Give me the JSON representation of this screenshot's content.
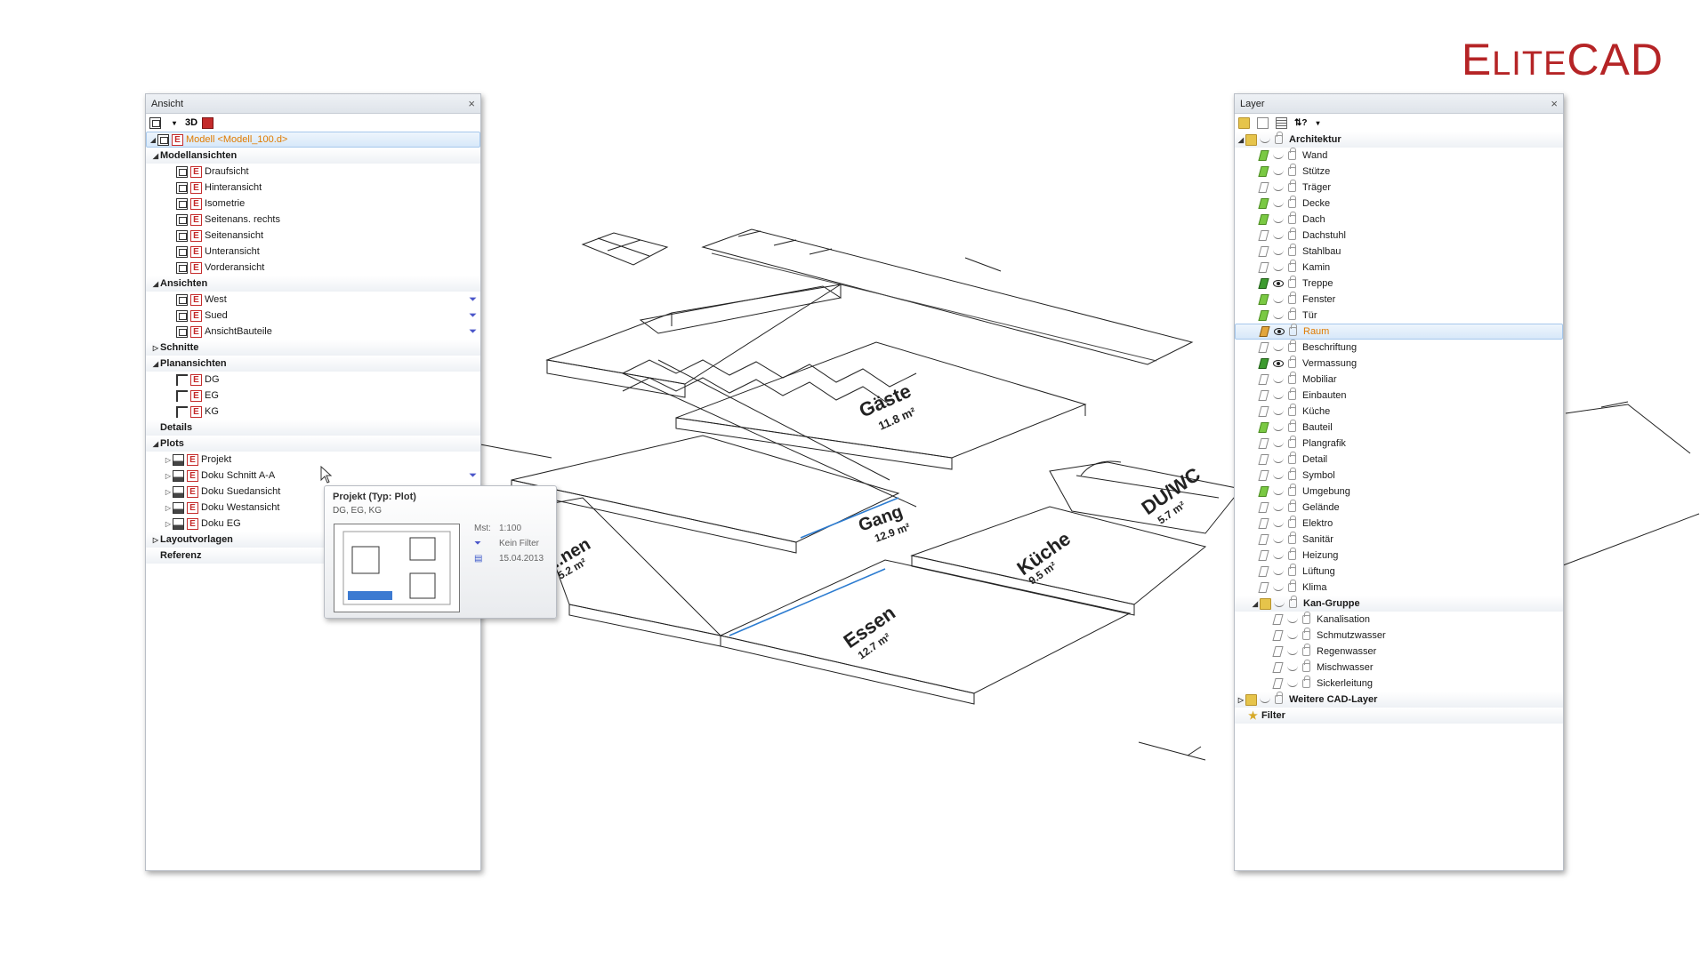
{
  "logo": {
    "first_big": "E",
    "first_small": "LITE",
    "rest": "CAD"
  },
  "ansicht": {
    "title": "Ansicht",
    "close": "×",
    "toolbar": {
      "mode_label": "3D"
    },
    "model_label": "Modell <Modell_100.d>",
    "modellansichten": {
      "label": "Modellansichten",
      "items": [
        "Draufsicht",
        "Hinteransicht",
        "Isometrie",
        "Seitenans. rechts",
        "Seitenansicht",
        "Unteransicht",
        "Vorderansicht"
      ]
    },
    "ansichten": {
      "label": "Ansichten",
      "items": [
        "West",
        "Sued",
        "AnsichtBauteile"
      ]
    },
    "schnitte": {
      "label": "Schnitte"
    },
    "planansichten": {
      "label": "Planansichten",
      "items": [
        "DG",
        "EG",
        "KG"
      ]
    },
    "details": {
      "label": "Details"
    },
    "plots": {
      "label": "Plots",
      "items": [
        "Projekt",
        "Doku Schnitt A-A",
        "Doku Suedansicht",
        "Doku Westansicht",
        "Doku EG"
      ]
    },
    "layoutvorlagen": {
      "label": "Layoutvorlagen"
    },
    "referenz": {
      "label": "Referenz"
    }
  },
  "tooltip": {
    "title": "Projekt  (Typ: Plot)",
    "subtitle": "DG, EG, KG",
    "scale_key": "Mst:",
    "scale_value": "1:100",
    "filter_value": "Kein Filter",
    "date_value": "15.04.2013"
  },
  "layer": {
    "title": "Layer",
    "close": "×",
    "groups": [
      {
        "label": "Architektur",
        "items": [
          {
            "label": "Wand",
            "state": "on"
          },
          {
            "label": "Stütze",
            "state": "on"
          },
          {
            "label": "Träger",
            "state": "off"
          },
          {
            "label": "Decke",
            "state": "on"
          },
          {
            "label": "Dach",
            "state": "on"
          },
          {
            "label": "Dachstuhl",
            "state": "off"
          },
          {
            "label": "Stahlbau",
            "state": "off"
          },
          {
            "label": "Kamin",
            "state": "off"
          },
          {
            "label": "Treppe",
            "state": "strong"
          },
          {
            "label": "Fenster",
            "state": "on"
          },
          {
            "label": "Tür",
            "state": "on"
          },
          {
            "label": "Raum",
            "state": "pen"
          },
          {
            "label": "Beschriftung",
            "state": "off"
          },
          {
            "label": "Vermassung",
            "state": "strong"
          },
          {
            "label": "Mobiliar",
            "state": "off"
          },
          {
            "label": "Einbauten",
            "state": "off"
          },
          {
            "label": "Küche",
            "state": "off"
          },
          {
            "label": "Bauteil",
            "state": "on"
          },
          {
            "label": "Plangrafik",
            "state": "off"
          },
          {
            "label": "Detail",
            "state": "off"
          },
          {
            "label": "Symbol",
            "state": "off"
          },
          {
            "label": "Umgebung",
            "state": "on"
          },
          {
            "label": "Gelände",
            "state": "off"
          },
          {
            "label": "Elektro",
            "state": "off"
          },
          {
            "label": "Sanitär",
            "state": "off"
          },
          {
            "label": "Heizung",
            "state": "off"
          },
          {
            "label": "Lüftung",
            "state": "off"
          },
          {
            "label": "Klima",
            "state": "off"
          }
        ]
      },
      {
        "label": "Kan-Gruppe",
        "items": [
          {
            "label": "Kanalisation",
            "state": "off"
          },
          {
            "label": "Schmutzwasser",
            "state": "off"
          },
          {
            "label": "Regenwasser",
            "state": "off"
          },
          {
            "label": "Mischwasser",
            "state": "off"
          },
          {
            "label": "Sickerleitung",
            "state": "off"
          }
        ]
      }
    ],
    "weitere": "Weitere CAD-Layer",
    "filter": "Filter"
  },
  "drawing": {
    "rooms": [
      {
        "name": "Gäste",
        "area": "11.8 m²"
      },
      {
        "name": "Gang",
        "area": "12.9 m²"
      },
      {
        "name": "DU/WC",
        "area": "5.7 m²"
      },
      {
        "name": "Küche",
        "area": "9.5 m²"
      },
      {
        "name": "Essen",
        "area": "12.7 m²"
      },
      {
        "name": "...nen",
        "area": "5.2 m²"
      }
    ]
  }
}
